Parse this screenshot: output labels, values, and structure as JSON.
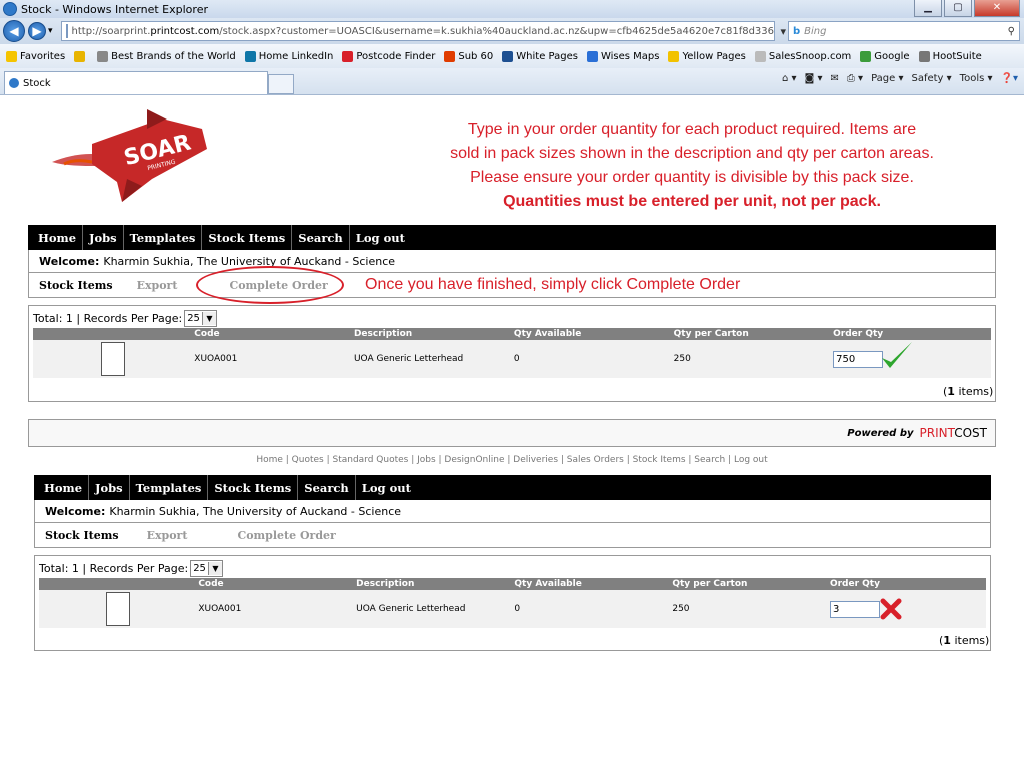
{
  "browser": {
    "window_title": "Stock - Windows Internet Explorer",
    "url_prefix": "http://soarprint.",
    "url_domain": "printcost.com",
    "url_rest": "/stock.aspx?customer=UOASCI&username=k.sukhia%40auckland.ac.nz&upw=cfb4625de5a4620e7c81f8d336fc8a4f",
    "search_placeholder": "Bing",
    "favorites_label": "Favorites",
    "favorites": [
      {
        "label": "Best Brands of the World",
        "color": "#888888"
      },
      {
        "label": "Home LinkedIn",
        "color": "#0e76a8"
      },
      {
        "label": "Postcode Finder",
        "color": "#d8202a"
      },
      {
        "label": "Sub 60",
        "color": "#e03c00"
      },
      {
        "label": "White Pages",
        "color": "#1d4f91"
      },
      {
        "label": "Wises Maps",
        "color": "#2a6fd6"
      },
      {
        "label": "Yellow Pages",
        "color": "#f2c200"
      },
      {
        "label": "SalesSnoop.com",
        "color": "#bbbbbb"
      },
      {
        "label": "Google",
        "color": "#3b9c3b"
      },
      {
        "label": "HootSuite",
        "color": "#777777"
      }
    ],
    "tab_title": "Stock",
    "commands": [
      "Page ▾",
      "Safety ▾",
      "Tools ▾"
    ]
  },
  "logo": {
    "text": "SOAR",
    "subtext": "PRINTING",
    "color": "#c62828"
  },
  "instructions": {
    "line1": "Type in your order quantity for each product required.  Items are",
    "line2": "sold in pack sizes shown in the description and qty per carton areas.",
    "line3": "Please ensure your order quantity is divisible by this pack size.",
    "line4": "Quantities must be entered per unit, not per pack."
  },
  "nav": [
    "Home",
    "Jobs",
    "Templates",
    "Stock Items",
    "Search",
    "Log out"
  ],
  "welcome": {
    "label": "Welcome:",
    "text": "Kharmin Sukhia, The University of Auckand - Science"
  },
  "subnav": {
    "current": "Stock Items",
    "export": "Export",
    "complete": "Complete Order"
  },
  "callout": "Once you have finished, simply click Complete Order",
  "listing": {
    "total_label": "Total: 1  |  Records Per Page:",
    "per_page": "25",
    "columns": [
      "Code",
      "Description",
      "Qty Available",
      "Qty per Carton",
      "Order Qty"
    ],
    "row": {
      "code": "XUOA001",
      "description": "UOA Generic Letterhead",
      "qty_available": "0",
      "qty_per_carton": "250"
    },
    "items_count": "1",
    "items_suffix": "items)",
    "items_prefix": "("
  },
  "order_qty_correct": "750",
  "order_qty_wrong": "3",
  "powered": {
    "label": "Powered by",
    "print": "PRINT",
    "cost": "COST"
  },
  "footer_links": "Home | Quotes | Standard Quotes | Jobs | DesignOnline | Deliveries | Sales Orders | Stock Items | Search | Log out"
}
